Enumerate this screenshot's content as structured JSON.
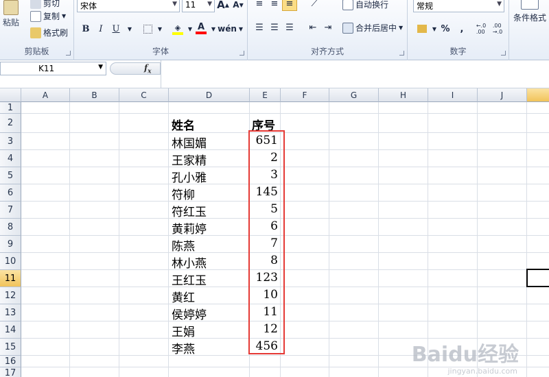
{
  "ribbon": {
    "clipboard": {
      "group_label": "剪贴板",
      "paste": "粘贴",
      "cut": "剪切",
      "copy": "复制",
      "format_painter": "格式刷"
    },
    "font": {
      "group_label": "字体",
      "font_name": "宋体",
      "font_size": "11",
      "bold": "B",
      "italic": "I",
      "underline": "U",
      "grow": "A",
      "shrink": "A",
      "fill_color": "#ffff00",
      "font_color": "#ff0000",
      "phonetic": "wén"
    },
    "alignment": {
      "group_label": "对齐方式",
      "wrap_text": "自动换行",
      "merge_center": "合并后居中"
    },
    "number": {
      "group_label": "数字",
      "format": "常规",
      "percent": "%",
      "comma": ","
    },
    "styles": {
      "conditional_format": "条件格式"
    }
  },
  "formula_bar": {
    "name_box": "K11",
    "fx": "fx",
    "formula": ""
  },
  "sheet": {
    "columns": [
      "A",
      "B",
      "C",
      "D",
      "E",
      "F",
      "G",
      "H",
      "I",
      "J"
    ],
    "rows": [
      "1",
      "2",
      "3",
      "4",
      "5",
      "6",
      "7",
      "8",
      "9",
      "10",
      "11",
      "12",
      "13",
      "14",
      "15",
      "16",
      "17"
    ],
    "selected_row": "11",
    "header_name": "姓名",
    "header_num": "序号",
    "data": [
      {
        "name": "林国媚",
        "num": "651"
      },
      {
        "name": "王家精",
        "num": "2"
      },
      {
        "name": "孔小雅",
        "num": "3"
      },
      {
        "name": "符柳",
        "num": "145"
      },
      {
        "name": "符红玉",
        "num": "5"
      },
      {
        "name": "黄莉婷",
        "num": "6"
      },
      {
        "name": "陈燕",
        "num": "7"
      },
      {
        "name": "林小燕",
        "num": "8"
      },
      {
        "name": "王红玉",
        "num": "123"
      },
      {
        "name": "黄红",
        "num": "10"
      },
      {
        "name": "侯婷婷",
        "num": "11"
      },
      {
        "name": "王娟",
        "num": "12"
      },
      {
        "name": "李燕",
        "num": "456"
      }
    ]
  },
  "watermark": {
    "logo": "Baidu经验",
    "url": "jingyan.baidu.com"
  },
  "colors": {
    "highlight_box": "#e53935",
    "selected_header": "#f1c35a"
  }
}
